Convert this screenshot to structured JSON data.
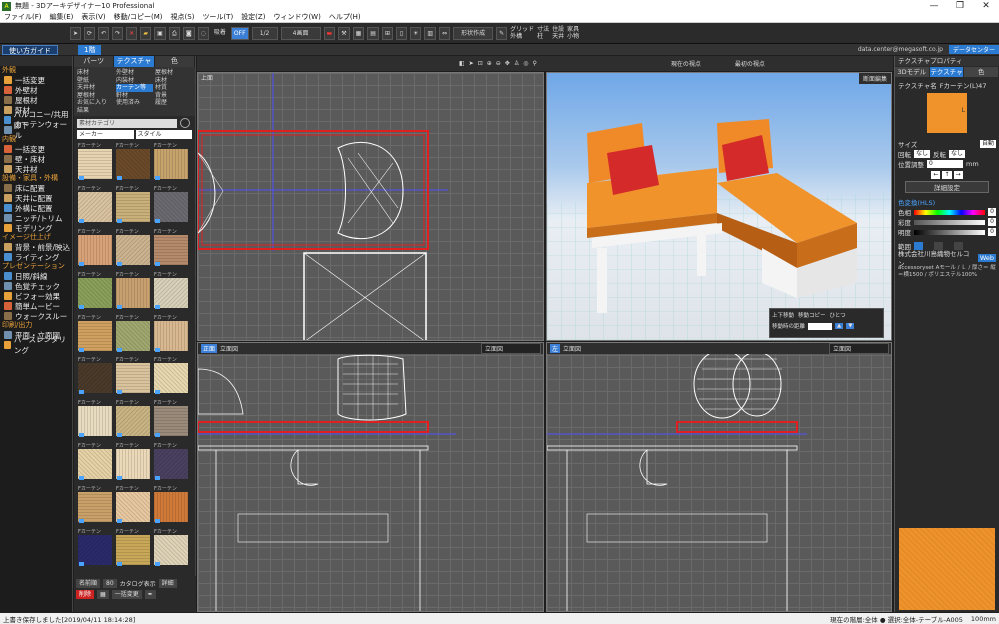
{
  "window": {
    "title": "無題 - 3Dアーキデザイナー10 Professional",
    "controls": [
      "—",
      "❐",
      "✕"
    ]
  },
  "menu": [
    "ファイル(F)",
    "編集(E)",
    "表示(V)",
    "移動/コピー(M)",
    "視点(S)",
    "ツール(T)",
    "設定(Z)",
    "ウィンドウ(W)",
    "ヘルプ(H)"
  ],
  "toolbar": {
    "snap_label": "吸着",
    "snap_state": "OFF",
    "scale": "1/2",
    "view_mode": "4画面",
    "shape_label": "形状作成",
    "checks": [
      "グリッド",
      "寸法",
      "住設",
      "家具",
      "外構",
      "柱",
      "天井",
      "小物",
      "室内"
    ]
  },
  "subbar": {
    "guide": "使い方ガイド",
    "floor_tab": "1階",
    "email": "data.center@megasoft.co.jp",
    "data_center": "データセンター"
  },
  "left_panel": {
    "sections": [
      {
        "title": "外観",
        "items": [
          "一括変更",
          "外壁材",
          "屋根材",
          "軒材",
          "バルコニー/共用廊下",
          "カーテンウォール"
        ]
      },
      {
        "title": "内観",
        "items": [
          "一括変更",
          "壁・床材",
          "天井材"
        ]
      },
      {
        "title": "設備・家具・外構",
        "items": [
          "床に配置",
          "天井に配置",
          "外構に配置",
          "ニッチ/トリム",
          "モデリング"
        ]
      },
      {
        "title": "イメージ仕上げ",
        "items": [
          "背景・前景/映込",
          "ライティング"
        ]
      },
      {
        "title": "プレゼンテーション",
        "items": [
          "日照/斜線",
          "色覚チェック",
          "ビフォー効果",
          "簡単ムービー",
          "ウォークスルー"
        ]
      },
      {
        "title": "印刷/出力",
        "items": [
          "平面・立面図",
          "パースレンダリング"
        ]
      }
    ]
  },
  "material_panel": {
    "tabs": [
      "パーツ",
      "テクスチャ",
      "色"
    ],
    "categories": [
      "床材",
      "外壁材",
      "屋根材",
      "壁紙",
      "内装材",
      "床材",
      "天井材",
      "カーテン等",
      "材質",
      "屋根材",
      "軒材",
      "背景",
      "お気に入り",
      "使用済み",
      "履歴",
      "結果"
    ],
    "search_placeholder": "素材カテゴリ",
    "maker": "メーカー",
    "style": "スタイル",
    "swatch_prefix": "Fカーテン",
    "footer": {
      "name_label": "名前順",
      "count_label": "80",
      "check_label": "カタログ表示",
      "detail": "詳細",
      "delete": "削除",
      "undo": "一括変更"
    }
  },
  "viewports": {
    "top": {
      "label": "上面"
    },
    "persp": {
      "tool": "断面編集",
      "controls": {
        "rotate": "上下移動",
        "copy": "移動コピー",
        "select": "ひとつ"
      },
      "distance_label": "移動時の距離"
    },
    "front": {
      "label": "正面",
      "mode": "立面図",
      "dropdown": "立面図"
    },
    "side": {
      "label": "左",
      "mode": "立面図",
      "dropdown": "立面図"
    }
  },
  "vp_toolbar": {
    "viewpoint": "現在の視点",
    "fixed": "最初の視点"
  },
  "right_panel": {
    "title": "テクスチャプロパティ",
    "tabs": [
      "3Dモデル",
      "テクスチャ",
      "色"
    ],
    "texture_label": "テクスチャ名",
    "texture_name": "Fカーテン(L)47",
    "preview_caption": "L",
    "size_label": "サイズ",
    "size_value": "自動",
    "rotate_label": "回転",
    "rotate_value": "なし",
    "mirror_label": "反転",
    "mirror_value": "なし",
    "offset_label": "位置調整",
    "offset_value": "0",
    "offset_unit": "mm",
    "detail_button": "詳細設定",
    "color_section": "色変換(HLS)",
    "hue_label": "色相",
    "hue_value": "0",
    "sat_label": "彩度",
    "sat_value": "0",
    "light_label": "明度",
    "light_value": "0",
    "range_label": "範囲",
    "company": "株式会社川島織物セルコン",
    "web": "Web",
    "desc": "accessoryset Aモール / Ｌ / 厚さ＝ 縦＝横1500 / ポリエステル100%"
  },
  "status": {
    "left": "上書き保存しました[2019/04/11 18:14:28]",
    "right": "現在の階層:全体 ● 選択:全体-テーブル-A005",
    "zoom": "100mm"
  },
  "colors": {
    "accent": "#2c7bd2",
    "section": "#e8a13a",
    "sofa": "#f0932b",
    "cushion_red": "#d42a2a",
    "wire_red": "#e02020"
  }
}
